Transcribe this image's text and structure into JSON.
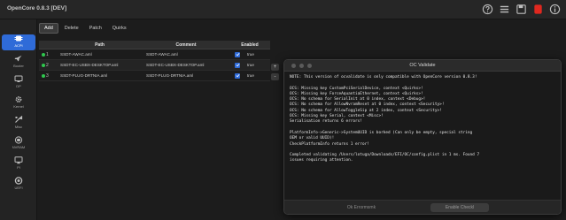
{
  "app": {
    "title": "OpenCore 0.8.3 [DEV]"
  },
  "titlebar_icons": [
    "help-icon",
    "list-icon",
    "save-icon",
    "flag-red-icon",
    "info-icon"
  ],
  "sidebar": {
    "items": [
      {
        "label": "ACPI",
        "icon": "chip-icon",
        "active": true
      },
      {
        "label": "Booter",
        "icon": "rocket-icon"
      },
      {
        "label": "DP",
        "icon": "display-icon"
      },
      {
        "label": "Kernel",
        "icon": "gear-icon"
      },
      {
        "label": "Misc",
        "icon": "tools-icon"
      },
      {
        "label": "NVRAM",
        "icon": "memory-icon"
      },
      {
        "label": "PI",
        "icon": "monitor-icon"
      },
      {
        "label": "UEFI",
        "icon": "circle-icon"
      }
    ]
  },
  "toolbar": {
    "tabs": [
      "Add",
      "Delete",
      "Patch",
      "Quirks"
    ],
    "active": 0
  },
  "table": {
    "headers": {
      "path": "Path",
      "comment": "Comment",
      "enabled": "Enabled"
    },
    "rows": [
      {
        "index": "1",
        "path": "SSDT-AWAC.aml",
        "comment": "SSDT-AWAC.aml",
        "enabled": "true"
      },
      {
        "index": "2",
        "path": "SSDT-EC-USBX-DESKTOP.aml",
        "comment": "SSDT-EC-USBX-DESKTOP.aml",
        "enabled": "true"
      },
      {
        "index": "3",
        "path": "SSDT-PLUG-DRTNIA.aml",
        "comment": "SSDT-PLUG-DRTNIA.aml",
        "enabled": "true"
      }
    ],
    "side_buttons": [
      "+",
      "-"
    ]
  },
  "dialog": {
    "title": "OC Validate",
    "lines": [
      "NOTE: This version of ocvalidate is only compatible with OpenCore version 0.8.3!",
      "",
      "OCS: Missing key CustomPciSerialDevice, context <Quirks>!",
      "OCS: Missing key ForceAquantiaEthernet, context <Quirks>!",
      "OCS: No schema for SerialInit at 0 index, context <Debug>!",
      "OCS: No schema for AllowNvramReset at 0 index, context <Security>!",
      "OCS: No schema for AllowToggleSip at 2 index, context <Security>!",
      "OCS: Missing key Serial, context <Misc>!",
      "Serialisation returns 6 errors!",
      "",
      "PlatformInfo->Generic->SystemUUID is borked (Can only be empty, special string",
      "OEM or valid UUID)!",
      "CheckPlatformInfo returns 1 error!",
      "",
      "Completed validating /Users/lotuga/Downloads/EFI/OC/config.plist in 1 ms. Found 7",
      "issues requiring attention."
    ],
    "buttons": {
      "left": "Ok Errormsmk",
      "right": "Enable Checkl"
    }
  }
}
